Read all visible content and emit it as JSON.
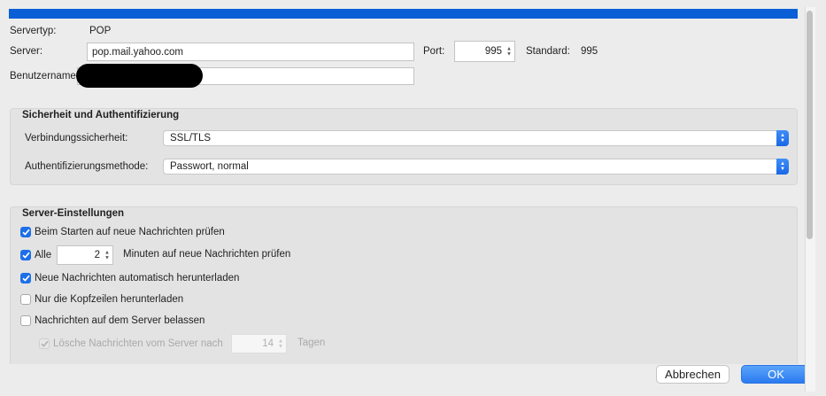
{
  "server": {
    "type_label": "Servertyp:",
    "type_value": "POP",
    "server_label": "Server:",
    "server_value": "pop.mail.yahoo.com",
    "port_label": "Port:",
    "port_value": "995",
    "standard_label": "Standard:",
    "standard_value": "995",
    "username_label": "Benutzername:",
    "username_value": ""
  },
  "security": {
    "title": "Sicherheit und Authentifizierung",
    "connection_label": "Verbindungssicherheit:",
    "connection_value": "SSL/TLS",
    "auth_label": "Authentifizierungsmethode:",
    "auth_value": "Passwort, normal"
  },
  "settings": {
    "title": "Server-Einstellungen",
    "check_on_start": "Beim Starten auf neue Nachrichten prüfen",
    "check_every_prefix": "Alle",
    "check_every_value": "2",
    "check_every_suffix": "Minuten auf neue Nachrichten prüfen",
    "auto_download": "Neue Nachrichten automatisch herunterladen",
    "headers_only": "Nur die Kopfzeilen herunterladen",
    "leave_on_server": "Nachrichten auf dem Server belassen",
    "delete_after_prefix": "Lösche Nachrichten vom Server nach",
    "delete_after_value": "14",
    "delete_after_suffix": "Tagen"
  },
  "buttons": {
    "cancel": "Abbrechen",
    "ok": "OK"
  },
  "colors": {
    "accent": "#0a5fd6",
    "checkbox": "#1c6fe8"
  }
}
